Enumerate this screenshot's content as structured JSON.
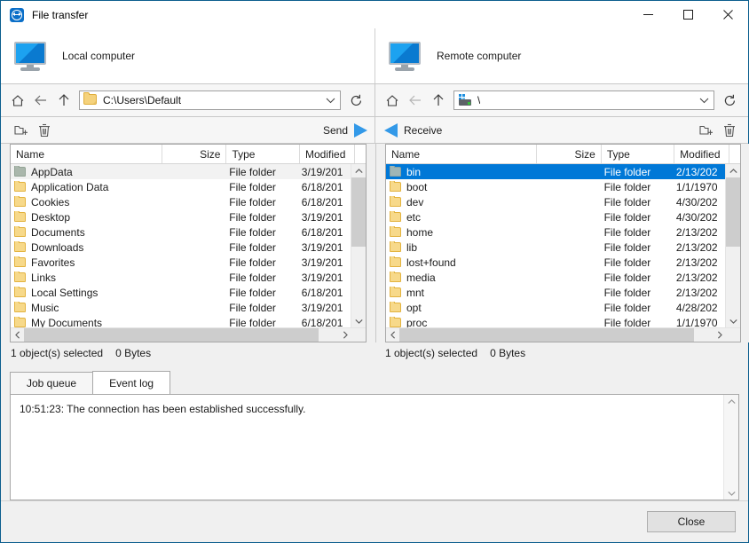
{
  "window": {
    "title": "File transfer",
    "logo_icon": "teamviewer-icon",
    "minimize_icon": "minimize-icon",
    "maximize_icon": "maximize-icon",
    "close_icon": "close-icon"
  },
  "headers": {
    "local": {
      "label": "Local computer",
      "icon": "monitor-icon"
    },
    "remote": {
      "label": "Remote computer",
      "icon": "monitor-icon"
    }
  },
  "local": {
    "address": {
      "value": "C:\\Users\\Default",
      "icon": "folder-icon"
    },
    "nav": {
      "home": "home-icon",
      "back": "back-arrow-icon",
      "up": "up-arrow-icon",
      "refresh": "refresh-icon",
      "dropdown": "chevron-down-icon"
    },
    "toolbar": {
      "new_folder": "new-folder-icon",
      "delete": "trash-icon",
      "transfer_label": "Send",
      "transfer_icon": "arrow-right-icon"
    },
    "columns": [
      "Name",
      "Size",
      "Type",
      "Modified"
    ],
    "rows": [
      {
        "name": "AppData",
        "size": "",
        "type": "File folder",
        "modified": "3/19/201",
        "state": "focused"
      },
      {
        "name": "Application Data",
        "size": "",
        "type": "File folder",
        "modified": "6/18/201",
        "state": ""
      },
      {
        "name": "Cookies",
        "size": "",
        "type": "File folder",
        "modified": "6/18/201",
        "state": ""
      },
      {
        "name": "Desktop",
        "size": "",
        "type": "File folder",
        "modified": "3/19/201",
        "state": ""
      },
      {
        "name": "Documents",
        "size": "",
        "type": "File folder",
        "modified": "6/18/201",
        "state": ""
      },
      {
        "name": "Downloads",
        "size": "",
        "type": "File folder",
        "modified": "3/19/201",
        "state": ""
      },
      {
        "name": "Favorites",
        "size": "",
        "type": "File folder",
        "modified": "3/19/201",
        "state": ""
      },
      {
        "name": "Links",
        "size": "",
        "type": "File folder",
        "modified": "3/19/201",
        "state": ""
      },
      {
        "name": "Local Settings",
        "size": "",
        "type": "File folder",
        "modified": "6/18/201",
        "state": ""
      },
      {
        "name": "Music",
        "size": "",
        "type": "File folder",
        "modified": "3/19/201",
        "state": ""
      },
      {
        "name": "My Documents",
        "size": "",
        "type": "File folder",
        "modified": "6/18/201",
        "state": ""
      }
    ],
    "status": {
      "selection": "1 object(s) selected",
      "size": "0 Bytes"
    }
  },
  "remote": {
    "address": {
      "value": "\\",
      "icon": "network-drive-icon"
    },
    "nav": {
      "home": "home-icon",
      "back": "back-arrow-icon",
      "up": "up-arrow-icon",
      "refresh": "refresh-icon",
      "dropdown": "chevron-down-icon"
    },
    "toolbar": {
      "new_folder": "new-folder-icon",
      "delete": "trash-icon",
      "transfer_label": "Receive",
      "transfer_icon": "arrow-left-icon"
    },
    "columns": [
      "Name",
      "Size",
      "Type",
      "Modified"
    ],
    "rows": [
      {
        "name": "bin",
        "size": "",
        "type": "File folder",
        "modified": "2/13/202",
        "state": "selected"
      },
      {
        "name": "boot",
        "size": "",
        "type": "File folder",
        "modified": "1/1/1970",
        "state": ""
      },
      {
        "name": "dev",
        "size": "",
        "type": "File folder",
        "modified": "4/30/202",
        "state": ""
      },
      {
        "name": "etc",
        "size": "",
        "type": "File folder",
        "modified": "4/30/202",
        "state": ""
      },
      {
        "name": "home",
        "size": "",
        "type": "File folder",
        "modified": "2/13/202",
        "state": ""
      },
      {
        "name": "lib",
        "size": "",
        "type": "File folder",
        "modified": "2/13/202",
        "state": ""
      },
      {
        "name": "lost+found",
        "size": "",
        "type": "File folder",
        "modified": "2/13/202",
        "state": ""
      },
      {
        "name": "media",
        "size": "",
        "type": "File folder",
        "modified": "2/13/202",
        "state": ""
      },
      {
        "name": "mnt",
        "size": "",
        "type": "File folder",
        "modified": "2/13/202",
        "state": ""
      },
      {
        "name": "opt",
        "size": "",
        "type": "File folder",
        "modified": "4/28/202",
        "state": ""
      },
      {
        "name": "proc",
        "size": "",
        "type": "File folder",
        "modified": "1/1/1970",
        "state": ""
      }
    ],
    "status": {
      "selection": "1 object(s) selected",
      "size": "0 Bytes"
    }
  },
  "bottom": {
    "tabs": [
      {
        "label": "Job queue",
        "active": false
      },
      {
        "label": "Event log",
        "active": true
      }
    ],
    "log_entry": "10:51:23: The connection has been established successfully."
  },
  "footer": {
    "close_label": "Close"
  },
  "colors": {
    "accent": "#0078d7",
    "arrow_blue": "#3399e8",
    "window_border": "#0b5e8e",
    "folder_yellow": "#f7d98a",
    "background": "#f0f0f0"
  }
}
